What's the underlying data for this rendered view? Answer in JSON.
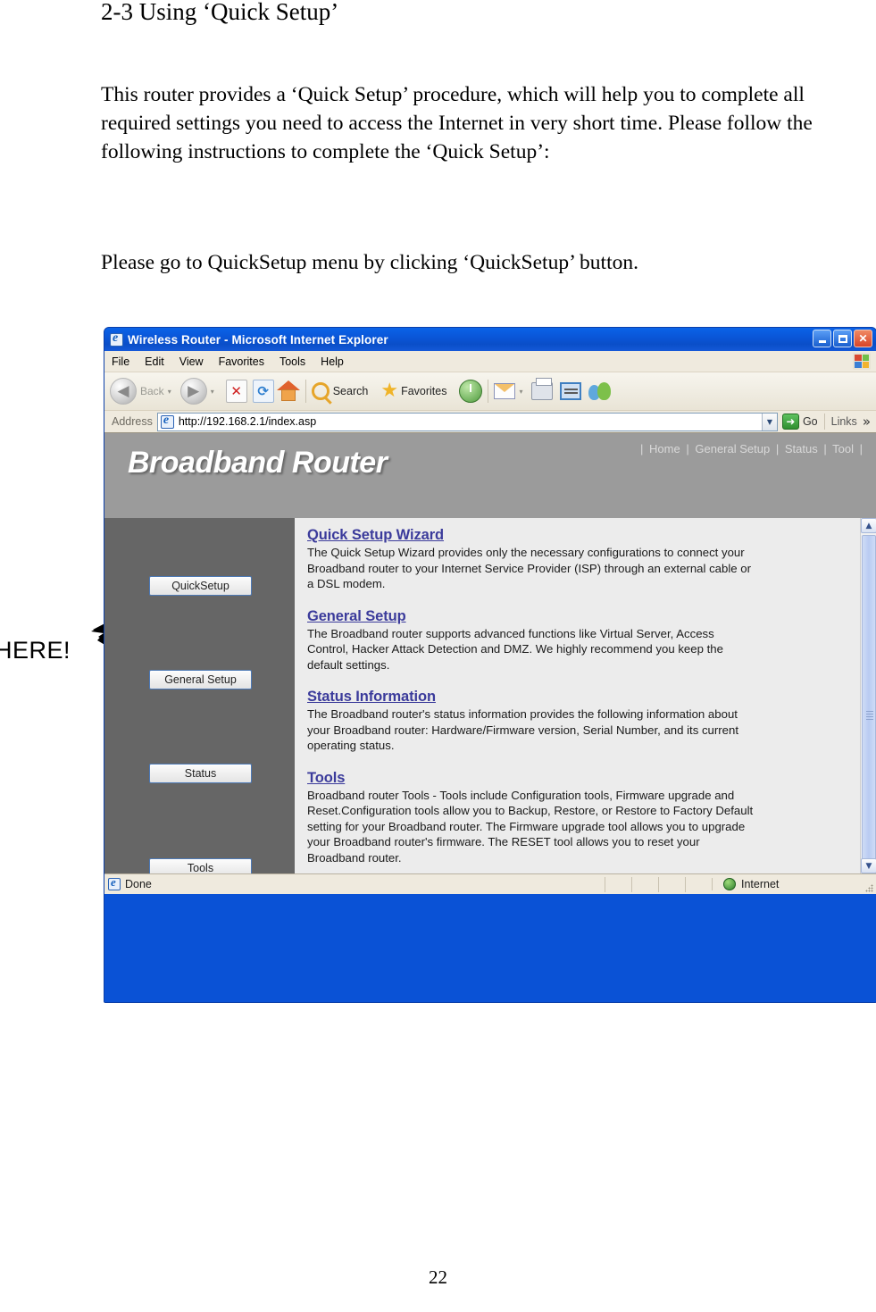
{
  "document": {
    "heading": "2-3 Using ‘Quick Setup’",
    "paragraph_1": "This router provides a ‘Quick Setup’ procedure, which will help you to complete all required settings you need to access the Internet in very short time. Please follow the following instructions to complete the ‘Quick Setup’:",
    "paragraph_2": "Please go to QuickSetup menu by clicking ‘QuickSetup’ button.",
    "page_number": "22",
    "annotation_label": "HERE!"
  },
  "browser": {
    "title": "Wireless Router - Microsoft Internet Explorer",
    "window_buttons": {
      "minimize": "_",
      "maximize": "□",
      "close": "✕"
    },
    "menu": [
      "File",
      "Edit",
      "View",
      "Favorites",
      "Tools",
      "Help"
    ],
    "toolbar": {
      "back_label": "Back",
      "forward_label": "",
      "stop_glyph": "✕",
      "refresh_glyph": "⟳",
      "search_label": "Search",
      "favorites_label": "Favorites",
      "back_caret": "▾",
      "forward_caret": "▾",
      "mail_caret": "▾",
      "back_arrow": "◀",
      "forward_arrow": "▶"
    },
    "address": {
      "label": "Address",
      "url": "http://192.168.2.1/index.asp",
      "dropdown_glyph": "▼",
      "go_label": "Go",
      "go_glyph": "➜",
      "links_label": "Links",
      "overflow_glyph": "»"
    },
    "status": {
      "text": "Done",
      "zone": "Internet"
    }
  },
  "router_page": {
    "brand": "Broadband Router",
    "nav": {
      "sep": "|",
      "items": [
        "Home",
        "General Setup",
        "Status",
        "Tool"
      ]
    },
    "sidebar_buttons": [
      "QuickSetup",
      "General Setup",
      "Status",
      "Tools"
    ],
    "sections": [
      {
        "title": "Quick Setup Wizard",
        "body": "The Quick Setup Wizard provides only the necessary configurations to connect your Broadband router to your Internet Service Provider (ISP) through an external cable or a DSL modem."
      },
      {
        "title": "General Setup",
        "body": "The Broadband router supports advanced functions like Virtual Server, Access Control, Hacker Attack Detection and DMZ. We highly recommend you keep the default settings."
      },
      {
        "title": "Status Information",
        "body": "The Broadband router's status information provides the following information about your Broadband router: Hardware/Firmware version, Serial Number, and its current operating status."
      },
      {
        "title": "Tools",
        "body": "Broadband router Tools - Tools include Configuration tools, Firmware upgrade and Reset.Configuration tools allow you to Backup, Restore, or Restore to Factory Default setting for your Broadband router. The Firmware upgrade tool allows you to upgrade your Broadband router's firmware. The RESET tool allows you to reset your Broadband router."
      }
    ],
    "scrollbar": {
      "up_glyph": "▲",
      "down_glyph": "▼"
    }
  },
  "colors": {
    "title_bar": "#0a56d8",
    "router_header": "#9b9b9b",
    "sidebar": "#666666",
    "content_bg": "#ececec",
    "link": "#3b3b9b",
    "chrome_bg": "#efeade"
  }
}
